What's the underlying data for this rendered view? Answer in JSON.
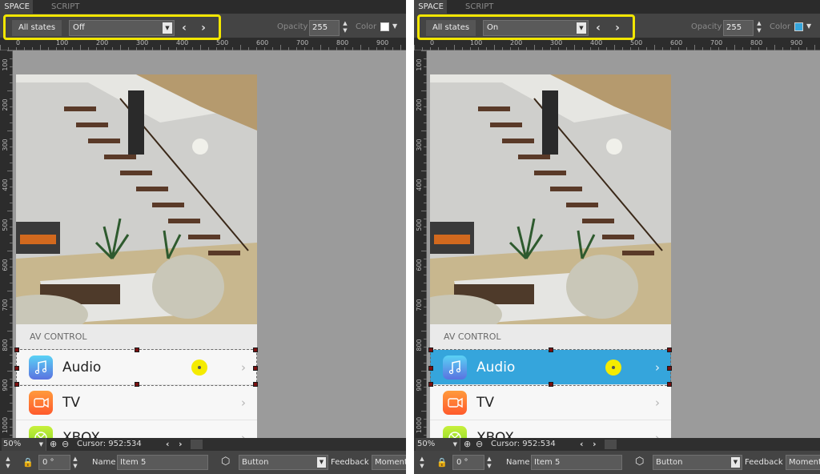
{
  "panels": [
    {
      "tabs": [
        "SPACE",
        "SCRIPT"
      ],
      "toolbar": {
        "states_button": "All states",
        "state_value": "Off",
        "prev": "‹",
        "next": "›",
        "opacity_label": "Opacity",
        "opacity_value": "255",
        "color_label": "Color",
        "color": "#ffffff"
      },
      "device": {
        "section_title": "AV CONTROL",
        "items": [
          {
            "label": "Audio",
            "icon": "music-icon"
          },
          {
            "label": "TV",
            "icon": "video-camera-icon"
          },
          {
            "label": "XBOX",
            "icon": "xbox-icon"
          }
        ],
        "selected_state": "off"
      },
      "status": {
        "zoom": "50%",
        "cursor": "Cursor: 952:534"
      },
      "props": {
        "angle": "0 °",
        "name_label": "Name",
        "name_value": "Item 5",
        "type_value": "Button",
        "feedback_label": "Feedback",
        "feedback_value": "Momentary"
      }
    },
    {
      "tabs": [
        "SPACE",
        "SCRIPT"
      ],
      "toolbar": {
        "states_button": "All states",
        "state_value": "On",
        "prev": "‹",
        "next": "›",
        "opacity_label": "Opacity",
        "opacity_value": "255",
        "color_label": "Color",
        "color": "#35a5dc"
      },
      "device": {
        "section_title": "AV CONTROL",
        "items": [
          {
            "label": "Audio",
            "icon": "music-icon"
          },
          {
            "label": "TV",
            "icon": "video-camera-icon"
          },
          {
            "label": "XBOX",
            "icon": "xbox-icon"
          }
        ],
        "selected_state": "on"
      },
      "status": {
        "zoom": "50%",
        "cursor": "Cursor: 952:534"
      },
      "props": {
        "angle": "0 °",
        "name_label": "Name",
        "name_value": "Item 5",
        "type_value": "Button",
        "feedback_label": "Feedback",
        "feedback_value": "Momentary"
      }
    }
  ],
  "ruler": {
    "h_ticks": [
      "0",
      "100",
      "200",
      "300",
      "400",
      "500",
      "600",
      "700",
      "800",
      "900"
    ],
    "v_ticks": [
      "100",
      "200",
      "300",
      "400",
      "500",
      "600",
      "700",
      "800",
      "900",
      "1000"
    ]
  },
  "theme": {
    "highlight": "#f2e600",
    "on_row": "#35a5dc"
  }
}
